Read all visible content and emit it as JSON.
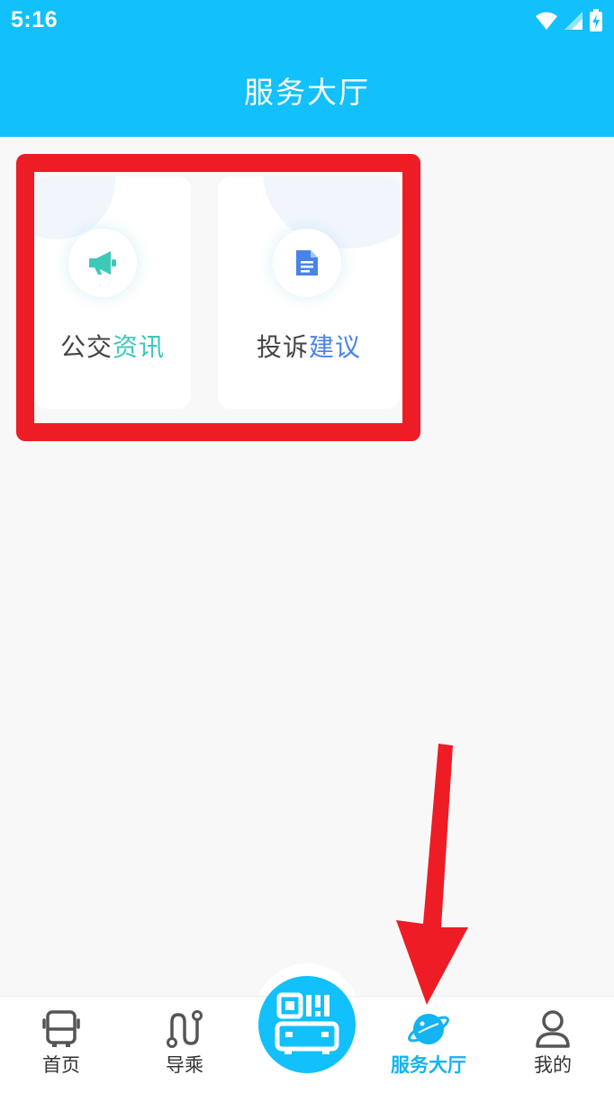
{
  "status_bar": {
    "time": "5:16"
  },
  "header": {
    "title": "服务大厅"
  },
  "services": [
    {
      "label_plain": "公交",
      "label_accent": "资讯",
      "icon": "megaphone-icon",
      "accent": "#3cc9b7"
    },
    {
      "label_plain": "投诉",
      "label_accent": "建议",
      "icon": "document-icon",
      "accent": "#4a83e8"
    }
  ],
  "bottom_nav": {
    "tabs": [
      {
        "label": "首页",
        "icon": "bus-icon"
      },
      {
        "label": "导乘",
        "icon": "route-icon"
      },
      {
        "label": "服务大厅",
        "icon": "planet-icon",
        "active": true
      },
      {
        "label": "我的",
        "icon": "user-icon"
      }
    ],
    "center_icon": "qr-bus-icon"
  },
  "colors": {
    "header": "#12c0fb",
    "active_tab": "#12b4f1",
    "annotation": "#ee1c25"
  }
}
